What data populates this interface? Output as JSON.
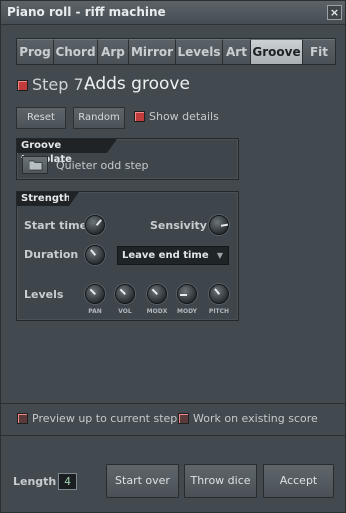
{
  "window": {
    "title": "Piano roll - riff machine",
    "close_glyph": "×"
  },
  "tabs": [
    {
      "label": "Prog",
      "active": false
    },
    {
      "label": "Chord",
      "active": false
    },
    {
      "label": "Arp",
      "active": false
    },
    {
      "label": "Mirror",
      "active": false
    },
    {
      "label": "Levels",
      "active": false
    },
    {
      "label": "Art",
      "active": false
    },
    {
      "label": "Groove",
      "active": true
    },
    {
      "label": "Fit",
      "active": false
    }
  ],
  "step": {
    "number": "Step 7.",
    "title": "Adds groove"
  },
  "toolbar": {
    "reset_label": "Reset",
    "random_label": "Random",
    "show_details_label": "Show details"
  },
  "groove_template": {
    "header": "Groove template",
    "value": "Quieter odd step"
  },
  "strength": {
    "header": "Strength",
    "start_time_label": "Start time",
    "sensivity_label": "Sensivity",
    "duration_label": "Duration",
    "duration_mode": "Leave end time",
    "levels_label": "Levels",
    "level_knobs": [
      "PAN",
      "VOL",
      "MODX",
      "MODY",
      "PITCH"
    ]
  },
  "options": {
    "preview_label": "Preview up to current step",
    "existing_score_label": "Work on existing score"
  },
  "footer": {
    "length_label": "Length",
    "length_value": "4",
    "start_over_label": "Start over",
    "throw_dice_label": "Throw dice",
    "accept_label": "Accept"
  },
  "colors": {
    "led_red": "#c03b3b",
    "active_tab": "#c4c9cc",
    "panel_dark": "#1f2326"
  }
}
